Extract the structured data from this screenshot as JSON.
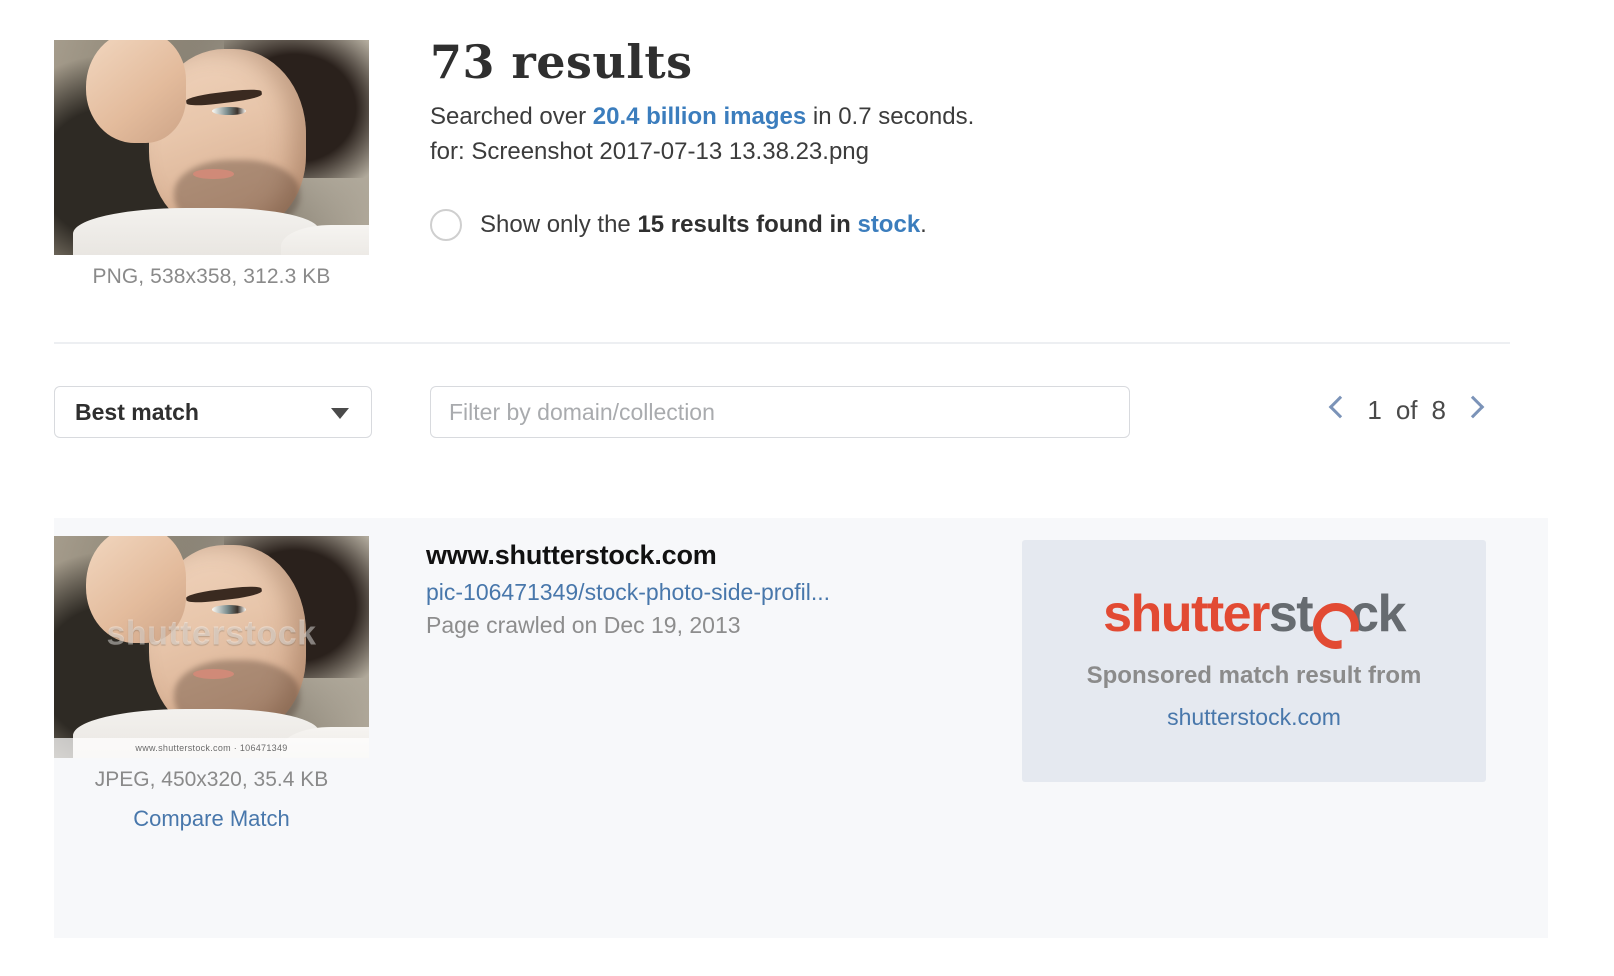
{
  "query": {
    "thumbnail_alt": "query-image-thumbnail",
    "file_info": "PNG, 538x358, 312.3 KB",
    "results_count": "73 results",
    "searched_prefix": "Searched over ",
    "searched_highlight": "20.4 billion images",
    "searched_suffix": " in 0.7 seconds.",
    "for_line": "for: Screenshot 2017-07-13 13.38.23.png",
    "stock_filter": {
      "prefix": "Show only the ",
      "bold": "15 results found in ",
      "link": "stock",
      "suffix": ".",
      "checked": false
    }
  },
  "controls": {
    "sort_value": "Best match",
    "sort_options": [
      "Best match"
    ],
    "filter_placeholder": "Filter by domain/collection",
    "filter_value": "",
    "pagination": {
      "prev_icon": "chevron-left-icon",
      "next_icon": "chevron-right-icon",
      "current_page": "1",
      "of_label": "of",
      "total_pages": "8"
    }
  },
  "results": [
    {
      "domain": "www.shutterstock.com",
      "path": "pic-106471349/stock-photo-side-profil...",
      "crawled": "Page crawled on Dec 19, 2013",
      "file_info": "JPEG, 450x320, 35.4 KB",
      "compare_label": "Compare Match",
      "watermark_text": "shutterstock",
      "watermark_strip": "www.shutterstock.com  ·  106471349",
      "sponsor": {
        "logo_part1": "shutter",
        "logo_part2": "st",
        "logo_icon": "shutterstock-o-icon",
        "logo_part3": "ck",
        "caption": "Sponsored match result from",
        "link": "shutterstock.com"
      }
    }
  ],
  "colors": {
    "link_blue": "#4877ab",
    "accent_blue": "#3b7dbd",
    "row_background": "#f7f8fa",
    "sponsor_background": "#e5e9f0",
    "shutterstock_red": "#e24a33",
    "shutterstock_gray": "#666b70"
  }
}
